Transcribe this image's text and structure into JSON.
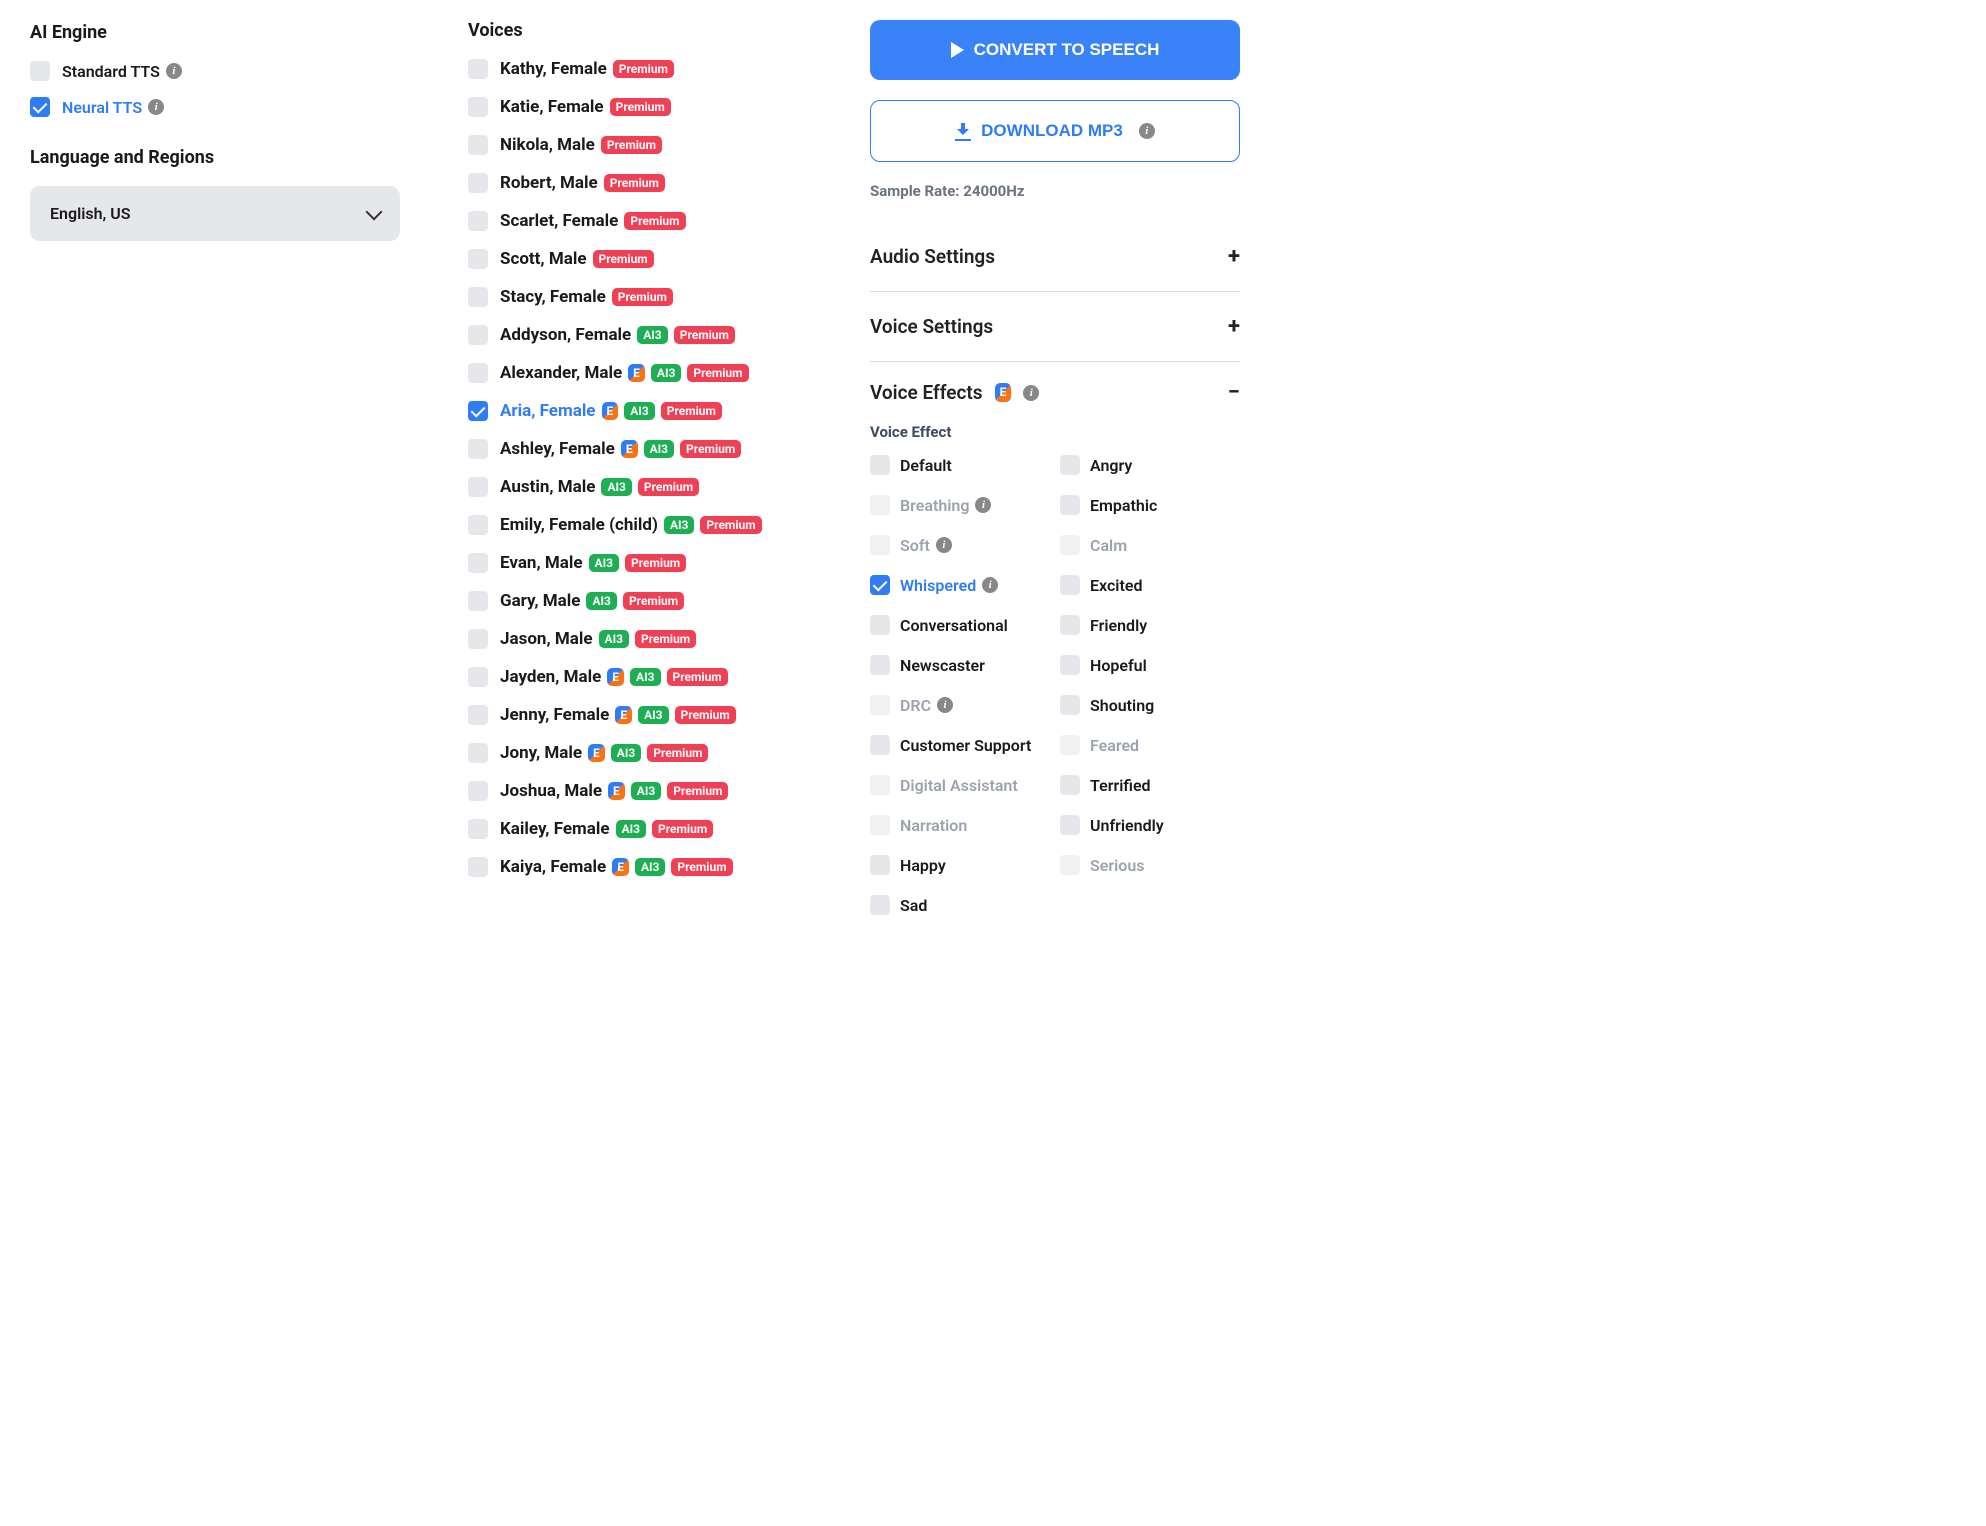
{
  "left": {
    "engine_title": "AI Engine",
    "engines": [
      {
        "label": "Standard TTS",
        "checked": false,
        "info": true
      },
      {
        "label": "Neural TTS",
        "checked": true,
        "info": true
      }
    ],
    "lang_title": "Language and Regions",
    "lang_value": "English, US"
  },
  "voices": {
    "title": "Voices",
    "items": [
      {
        "name": "Kathy, Female",
        "badges": [
          "premium"
        ]
      },
      {
        "name": "Katie, Female",
        "badges": [
          "premium"
        ]
      },
      {
        "name": "Nikola, Male",
        "badges": [
          "premium"
        ]
      },
      {
        "name": "Robert, Male",
        "badges": [
          "premium"
        ]
      },
      {
        "name": "Scarlet, Female",
        "badges": [
          "premium"
        ]
      },
      {
        "name": "Scott, Male",
        "badges": [
          "premium"
        ]
      },
      {
        "name": "Stacy, Female",
        "badges": [
          "premium"
        ]
      },
      {
        "name": "Addyson, Female",
        "badges": [
          "ai3",
          "premium"
        ]
      },
      {
        "name": "Alexander, Male",
        "badges": [
          "e",
          "ai3",
          "premium"
        ]
      },
      {
        "name": "Aria, Female",
        "badges": [
          "e",
          "ai3",
          "premium"
        ],
        "selected": true
      },
      {
        "name": "Ashley, Female",
        "badges": [
          "e",
          "ai3",
          "premium"
        ]
      },
      {
        "name": "Austin, Male",
        "badges": [
          "ai3",
          "premium"
        ]
      },
      {
        "name": "Emily, Female (child)",
        "badges": [
          "ai3",
          "premium"
        ]
      },
      {
        "name": "Evan, Male",
        "badges": [
          "ai3",
          "premium"
        ]
      },
      {
        "name": "Gary, Male",
        "badges": [
          "ai3",
          "premium"
        ]
      },
      {
        "name": "Jason, Male",
        "badges": [
          "ai3",
          "premium"
        ]
      },
      {
        "name": "Jayden, Male",
        "badges": [
          "e",
          "ai3",
          "premium"
        ]
      },
      {
        "name": "Jenny, Female",
        "badges": [
          "e",
          "ai3",
          "premium"
        ]
      },
      {
        "name": "Jony, Male",
        "badges": [
          "e",
          "ai3",
          "premium"
        ]
      },
      {
        "name": "Joshua, Male",
        "badges": [
          "e",
          "ai3",
          "premium"
        ]
      },
      {
        "name": "Kailey, Female",
        "badges": [
          "ai3",
          "premium"
        ]
      },
      {
        "name": "Kaiya, Female",
        "badges": [
          "e",
          "ai3",
          "premium"
        ]
      }
    ]
  },
  "right": {
    "convert_label": "CONVERT TO SPEECH",
    "download_label": "DOWNLOAD MP3",
    "sample_rate": "Sample Rate: 24000Hz",
    "accordions": [
      {
        "title": "Audio Settings",
        "open": false
      },
      {
        "title": "Voice Settings",
        "open": false
      }
    ],
    "effects_title": "Voice Effects",
    "effects_subtitle": "Voice Effect",
    "effects_left": [
      {
        "label": "Default"
      },
      {
        "label": "Breathing",
        "muted": true,
        "info": true
      },
      {
        "label": "Soft",
        "muted": true,
        "info": true
      },
      {
        "label": "Whispered",
        "checked": true,
        "blue": true,
        "info": true
      },
      {
        "label": "Conversational"
      },
      {
        "label": "Newscaster"
      },
      {
        "label": "DRC",
        "muted": true,
        "info": true
      },
      {
        "label": "Customer Support"
      },
      {
        "label": "Digital Assistant",
        "muted": true
      },
      {
        "label": "Narration",
        "muted": true
      },
      {
        "label": "Happy"
      },
      {
        "label": "Sad"
      }
    ],
    "effects_right": [
      {
        "label": "Angry"
      },
      {
        "label": "Empathic"
      },
      {
        "label": "Calm",
        "muted": true
      },
      {
        "label": "Excited"
      },
      {
        "label": "Friendly"
      },
      {
        "label": "Hopeful"
      },
      {
        "label": "Shouting"
      },
      {
        "label": "Feared",
        "muted": true
      },
      {
        "label": "Terrified"
      },
      {
        "label": "Unfriendly"
      },
      {
        "label": "Serious",
        "muted": true
      }
    ]
  },
  "badge_text": {
    "premium": "Premium",
    "ai3": "AI3",
    "e": "E"
  }
}
